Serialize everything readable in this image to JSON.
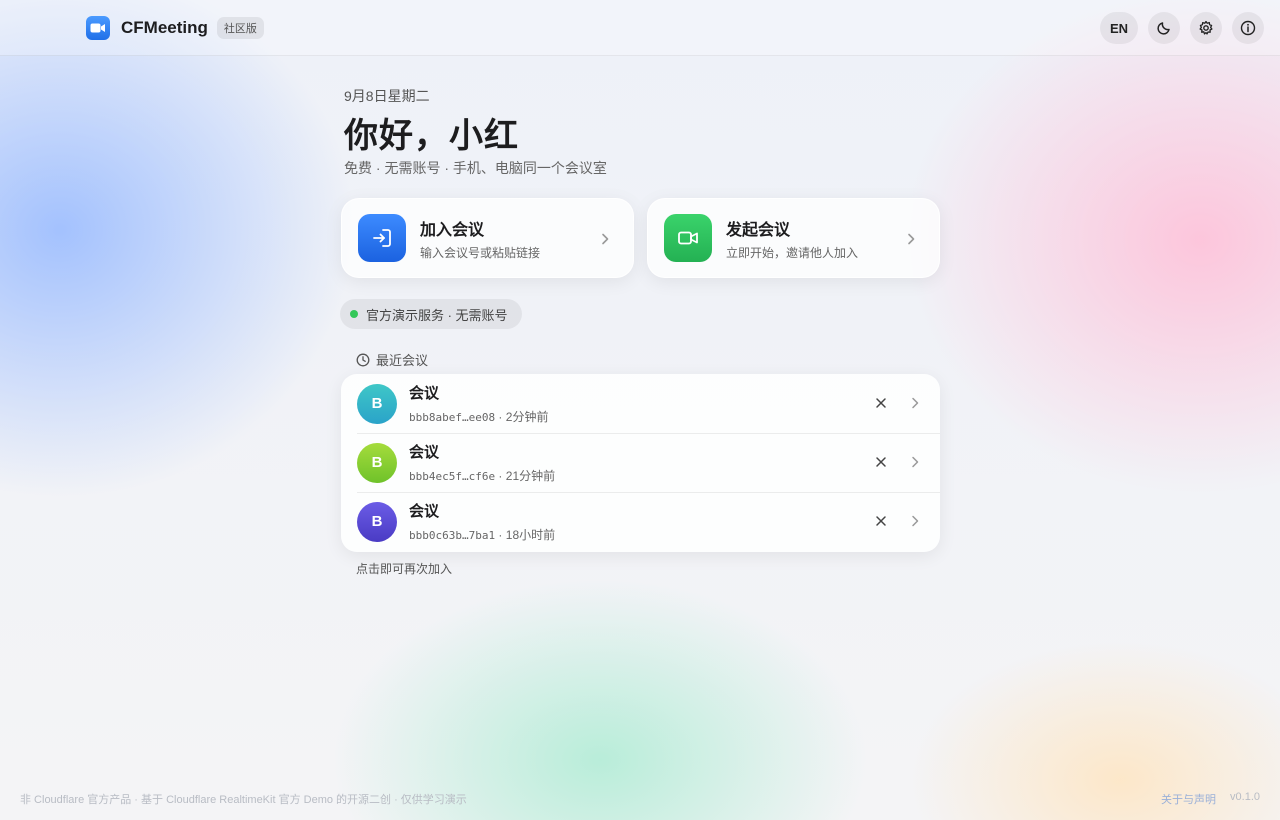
{
  "header": {
    "brand": "CFMeeting",
    "edition": "社区版",
    "lang_button": "EN",
    "icons": [
      "video-camera-icon",
      "moon-icon",
      "gear-icon",
      "info-icon"
    ]
  },
  "main": {
    "date": "9月8日星期二",
    "greeting": "你好，小红",
    "subtitle": "免费 · 无需账号 · 手机、电脑同一个会议室",
    "join": {
      "title": "加入会议",
      "desc": "输入会议号或粘贴链接",
      "color": "#1b62e0"
    },
    "start": {
      "title": "发起会议",
      "desc": "立即开始，邀请他人加入",
      "color": "#24b153"
    },
    "service_status": "官方演示服务 · 无需账号",
    "service_status_color": "#34c759",
    "recent_heading": "最近会议",
    "recent": [
      {
        "initial": "B",
        "title": "会议",
        "id": "bbb8abef…ee08",
        "time": "2分钟前",
        "color": "#2fb5c8"
      },
      {
        "initial": "B",
        "title": "会议",
        "id": "bbb4ec5f…cf6e",
        "time": "21分钟前",
        "color": "#8bcf2a"
      },
      {
        "initial": "B",
        "title": "会议",
        "id": "bbb0c63b…7ba1",
        "time": "18小时前",
        "color": "#5a49d6"
      }
    ],
    "hint": "点击即可再次加入"
  },
  "footer": {
    "disclaimer": "非 Cloudflare 官方产品 · 基于 Cloudflare RealtimeKit 官方 Demo 的开源二创 · 仅供学习演示",
    "about": "关于与声明",
    "version": "v0.1.0"
  }
}
